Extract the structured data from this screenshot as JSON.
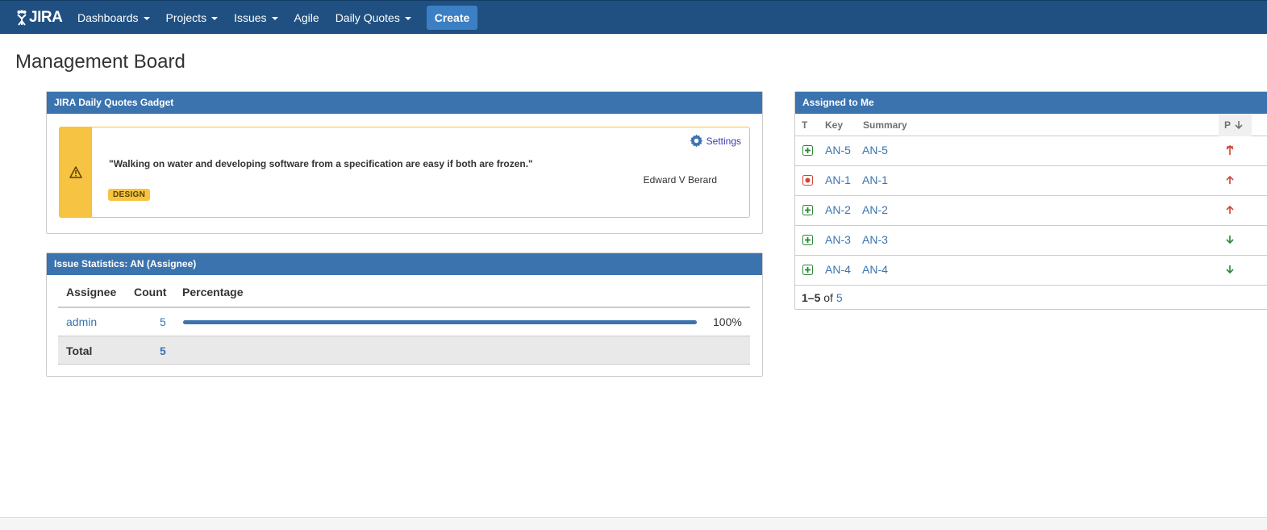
{
  "header": {
    "logo_text": "JIRA",
    "nav": [
      {
        "label": "Dashboards",
        "dropdown": true
      },
      {
        "label": "Projects",
        "dropdown": true
      },
      {
        "label": "Issues",
        "dropdown": true
      },
      {
        "label": "Agile",
        "dropdown": false
      },
      {
        "label": "Daily Quotes",
        "dropdown": true
      }
    ],
    "create_label": "Create"
  },
  "page": {
    "title": "Management Board"
  },
  "quotes_gadget": {
    "title": "JIRA Daily Quotes Gadget",
    "settings_label": "Settings",
    "quote": "\"Walking on water and developing software from a specification are easy if both are frozen.\"",
    "author": "Edward V Berard",
    "tag": "DESIGN",
    "icon": "warning-icon"
  },
  "stats_gadget": {
    "title": "Issue Statistics: AN (Assignee)",
    "columns": {
      "assignee": "Assignee",
      "count": "Count",
      "percentage": "Percentage"
    },
    "rows": [
      {
        "assignee": "admin",
        "count": "5",
        "percentage_label": "100%",
        "fraction": 1.0
      }
    ],
    "total": {
      "label": "Total",
      "count": "5"
    }
  },
  "assigned_gadget": {
    "title": "Assigned to Me",
    "columns": {
      "type": "T",
      "key": "Key",
      "summary": "Summary",
      "priority": "P"
    },
    "rows": [
      {
        "type": "improvement",
        "key": "AN-5",
        "summary": "AN-5",
        "priority": "highest"
      },
      {
        "type": "bug",
        "key": "AN-1",
        "summary": "AN-1",
        "priority": "high"
      },
      {
        "type": "improvement",
        "key": "AN-2",
        "summary": "AN-2",
        "priority": "high"
      },
      {
        "type": "improvement",
        "key": "AN-3",
        "summary": "AN-3",
        "priority": "low"
      },
      {
        "type": "improvement",
        "key": "AN-4",
        "summary": "AN-4",
        "priority": "low"
      }
    ],
    "pager": {
      "range": "1–5",
      "of": "of",
      "total": "5"
    }
  },
  "colors": {
    "header": "#205081",
    "gadget_header": "#3b73af",
    "create": "#3b7fc4",
    "warning": "#f6c342",
    "link": "#3b73af"
  }
}
